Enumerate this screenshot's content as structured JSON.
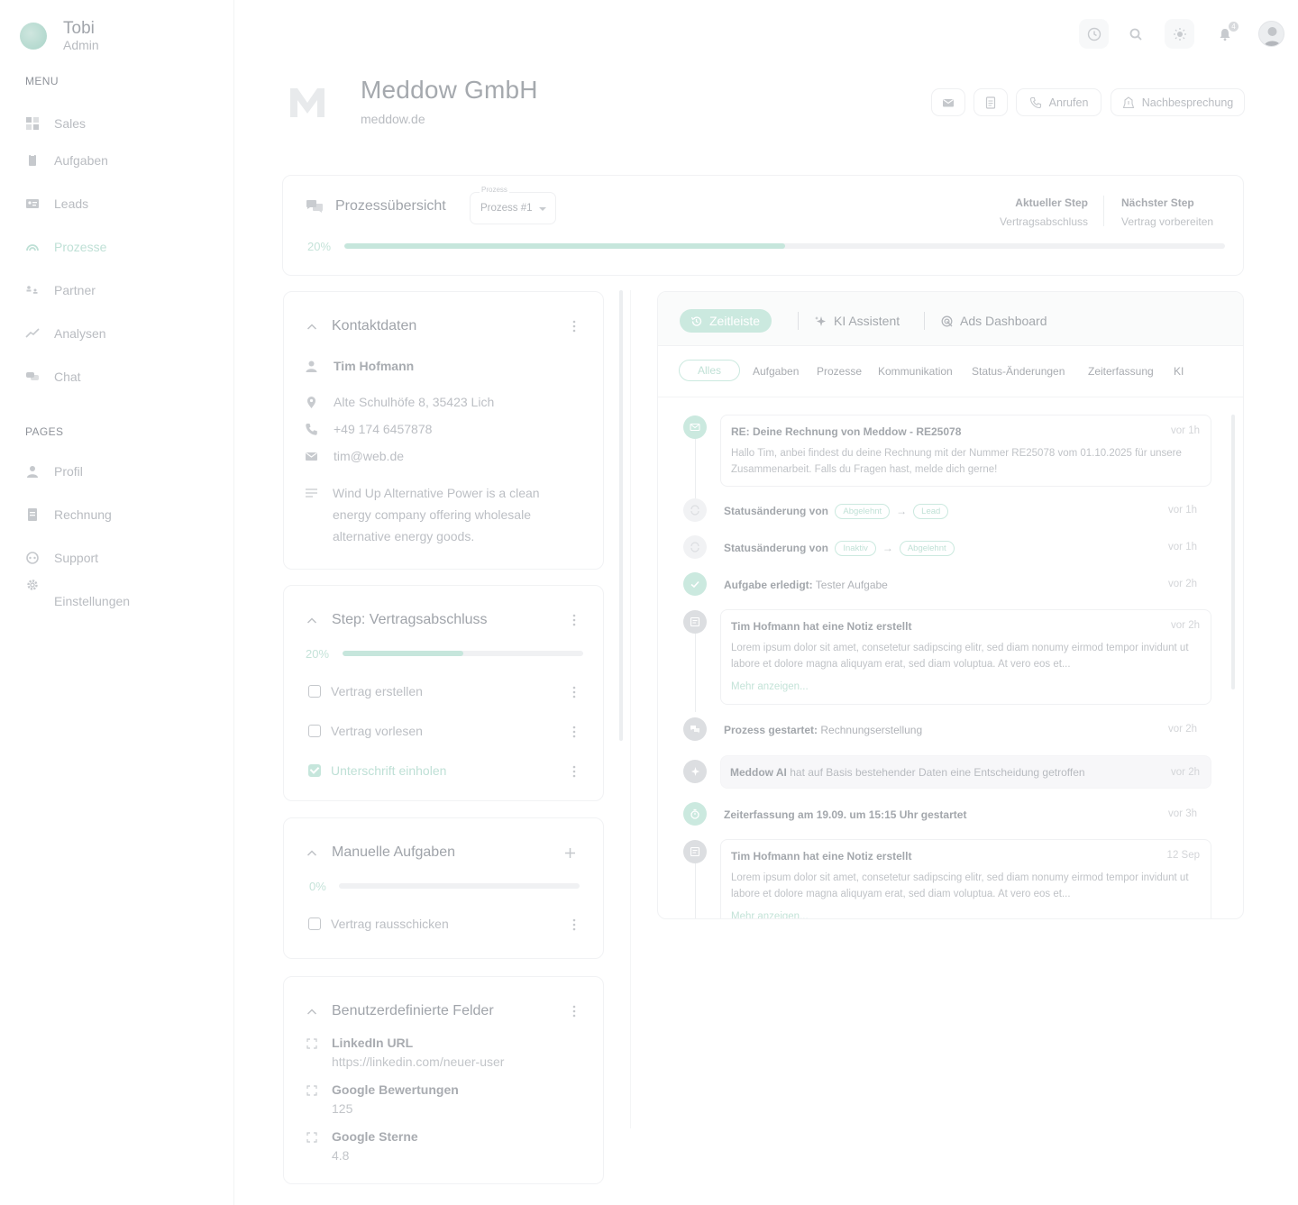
{
  "user": {
    "name": "Tobi",
    "role": "Admin"
  },
  "sidebar": {
    "menu_label": "MENU",
    "menu": [
      {
        "label": "Sales",
        "icon": "grid-icon"
      },
      {
        "label": "Aufgaben",
        "icon": "clipboard-icon"
      },
      {
        "label": "Leads",
        "icon": "contact-card-icon"
      },
      {
        "label": "Prozesse",
        "icon": "rainbow-icon",
        "active": true
      },
      {
        "label": "Partner",
        "icon": "users-icon"
      },
      {
        "label": "Analysen",
        "icon": "trend-icon"
      },
      {
        "label": "Chat",
        "icon": "chat-icon"
      }
    ],
    "pages_label": "PAGES",
    "pages": [
      {
        "label": "Profil",
        "icon": "user-icon"
      },
      {
        "label": "Rechnung",
        "icon": "invoice-icon"
      },
      {
        "label": "Support",
        "icon": "support-icon"
      },
      {
        "label": "Einstellungen",
        "icon": "gear-icon"
      }
    ]
  },
  "topbar": {
    "notification_count": "4"
  },
  "company": {
    "name": "Meddow GmbH",
    "domain": "meddow.de"
  },
  "header_actions": {
    "call_label": "Anrufen",
    "debrief_label": "Nachbesprechung"
  },
  "process": {
    "title": "Prozessübersicht",
    "select_label": "Prozess",
    "select_value": "Prozess #1",
    "current_step_label": "Aktueller Step",
    "current_step_value": "Vertragsabschluss",
    "next_step_label": "Nächster Step",
    "next_step_value": "Vertrag vorbereiten",
    "progress_label": "20%",
    "progress": 0.5
  },
  "contact": {
    "title": "Kontaktdaten",
    "name": "Tim Hofmann",
    "address": "Alte Schulhöfe 8, 35423 Lich",
    "phone": "+49 174 6457878",
    "email": "tim@web.de",
    "description": "Wind Up Alternative Power is a clean energy company offering wholesale alternative energy goods."
  },
  "step": {
    "title": "Step: Vertragsabschluss",
    "progress_label": "20%",
    "progress": 0.5,
    "tasks": [
      {
        "label": "Vertrag erstellen",
        "done": false
      },
      {
        "label": "Vertrag vorlesen",
        "done": false
      },
      {
        "label": "Unterschrift einholen",
        "done": true
      }
    ]
  },
  "manual": {
    "title": "Manuelle Aufgaben",
    "progress_label": "0%",
    "progress": 0,
    "tasks": [
      {
        "label": "Vertrag rausschicken",
        "done": false
      }
    ]
  },
  "custom_fields": {
    "title": "Benutzerdefinierte Felder",
    "fields": [
      {
        "name": "LinkedIn URL",
        "value": "https://linkedin.com/neuer-user"
      },
      {
        "name": "Google Bewertungen",
        "value": "125"
      },
      {
        "name": "Google Sterne",
        "value": "4.8"
      }
    ]
  },
  "timeline": {
    "tabs": [
      "Zeitleiste",
      "KI Assistent",
      "Ads Dashboard"
    ],
    "filters": [
      "Alles",
      "Aufgaben",
      "Prozesse",
      "Kommunikation",
      "Status-Änderungen",
      "Zeiterfassung",
      "KI"
    ],
    "events": {
      "mail": {
        "title": "RE: Deine Rechnung von Meddow - RE25078",
        "time": "vor 1h",
        "body": "Hallo Tim, anbei findest du deine Rechnung mit der Nummer RE25078 vom 01.10.2025 für unsere Zusammenarbeit. Falls du Fragen hast, melde dich gerne!"
      },
      "status1": {
        "prefix": "Statusänderung von",
        "from": "Abgelehnt",
        "to": "Lead",
        "time": "vor 1h"
      },
      "status2": {
        "prefix": "Statusänderung von",
        "from": "Inaktiv",
        "to": "Abgelehnt",
        "time": "vor 1h"
      },
      "task": {
        "bold": "Aufgabe erledigt:",
        "text": "Tester Aufgabe",
        "time": "vor 2h"
      },
      "note1": {
        "title": "Tim Hofmann hat eine Notiz erstellt",
        "time": "vor 2h",
        "body": "Lorem ipsum dolor sit amet, consetetur sadipscing elitr, sed diam nonumy eirmod tempor invidunt ut labore et dolore magna aliquyam erat, sed diam voluptua. At vero eos et...",
        "more": "Mehr anzeigen..."
      },
      "process": {
        "bold": "Prozess gestartet:",
        "text": "Rechnungserstellung",
        "time": "vor 2h"
      },
      "ai": {
        "bold": "Meddow AI",
        "text": "hat auf Basis bestehender Daten eine Entscheidung getroffen",
        "time": "vor 2h"
      },
      "timer": {
        "bold": "Zeiterfassung am 19.09. um 15:15 Uhr gestartet",
        "time": "vor 3h"
      },
      "note2": {
        "title": "Tim Hofmann hat eine Notiz erstellt",
        "time": "12 Sep",
        "body": "Lorem ipsum dolor sit amet, consetetur sadipscing elitr, sed diam nonumy eirmod tempor invidunt ut labore et dolore magna aliquyam erat, sed diam voluptua. At vero eos et...",
        "more": "Mehr anzeigen..."
      }
    }
  },
  "colors": {
    "accent": "#cbe9df",
    "text_muted": "#b9bcc1"
  }
}
